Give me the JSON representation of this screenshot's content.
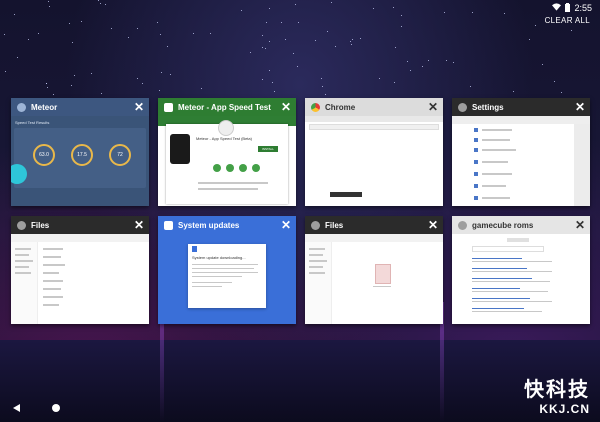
{
  "status_bar": {
    "time": "2:55"
  },
  "clear_all_label": "CLEAR ALL",
  "cards": [
    {
      "title": "Meteor",
      "header_color": "#3d5780",
      "icon_color": "#9db4d6",
      "content": {
        "title": "Speed Test Results",
        "metrics": [
          "63.0",
          "17.5",
          "72"
        ]
      }
    },
    {
      "title": "Meteor - App Speed Test",
      "header_color": "#2e7d32",
      "icon_color": "#ffffff",
      "content": {
        "app_name": "Meteor - App Speed Test (Beta)",
        "button": "INSTALL"
      }
    },
    {
      "title": "Chrome",
      "header_color": "#dcdcdc",
      "icon_color": "#e53935",
      "dark_text": true
    },
    {
      "title": "Settings",
      "header_color": "#2b2b2b",
      "icon_color": "#9e9e9e"
    },
    {
      "title": "Files",
      "header_color": "#2b2b2b",
      "icon_color": "#9e9e9e"
    },
    {
      "title": "System updates",
      "header_color": "#3a6fd8",
      "icon_color": "#ffffff",
      "content": {
        "heading": "System update downloading..."
      }
    },
    {
      "title": "Files",
      "header_color": "#2b2b2b",
      "icon_color": "#9e9e9e"
    },
    {
      "title": "gamecube roms",
      "header_color": "#e5e5e5",
      "icon_color": "#9e9e9e",
      "dark_text": true
    }
  ],
  "watermark": {
    "cn": "快科技",
    "en": "KKJ.CN"
  }
}
